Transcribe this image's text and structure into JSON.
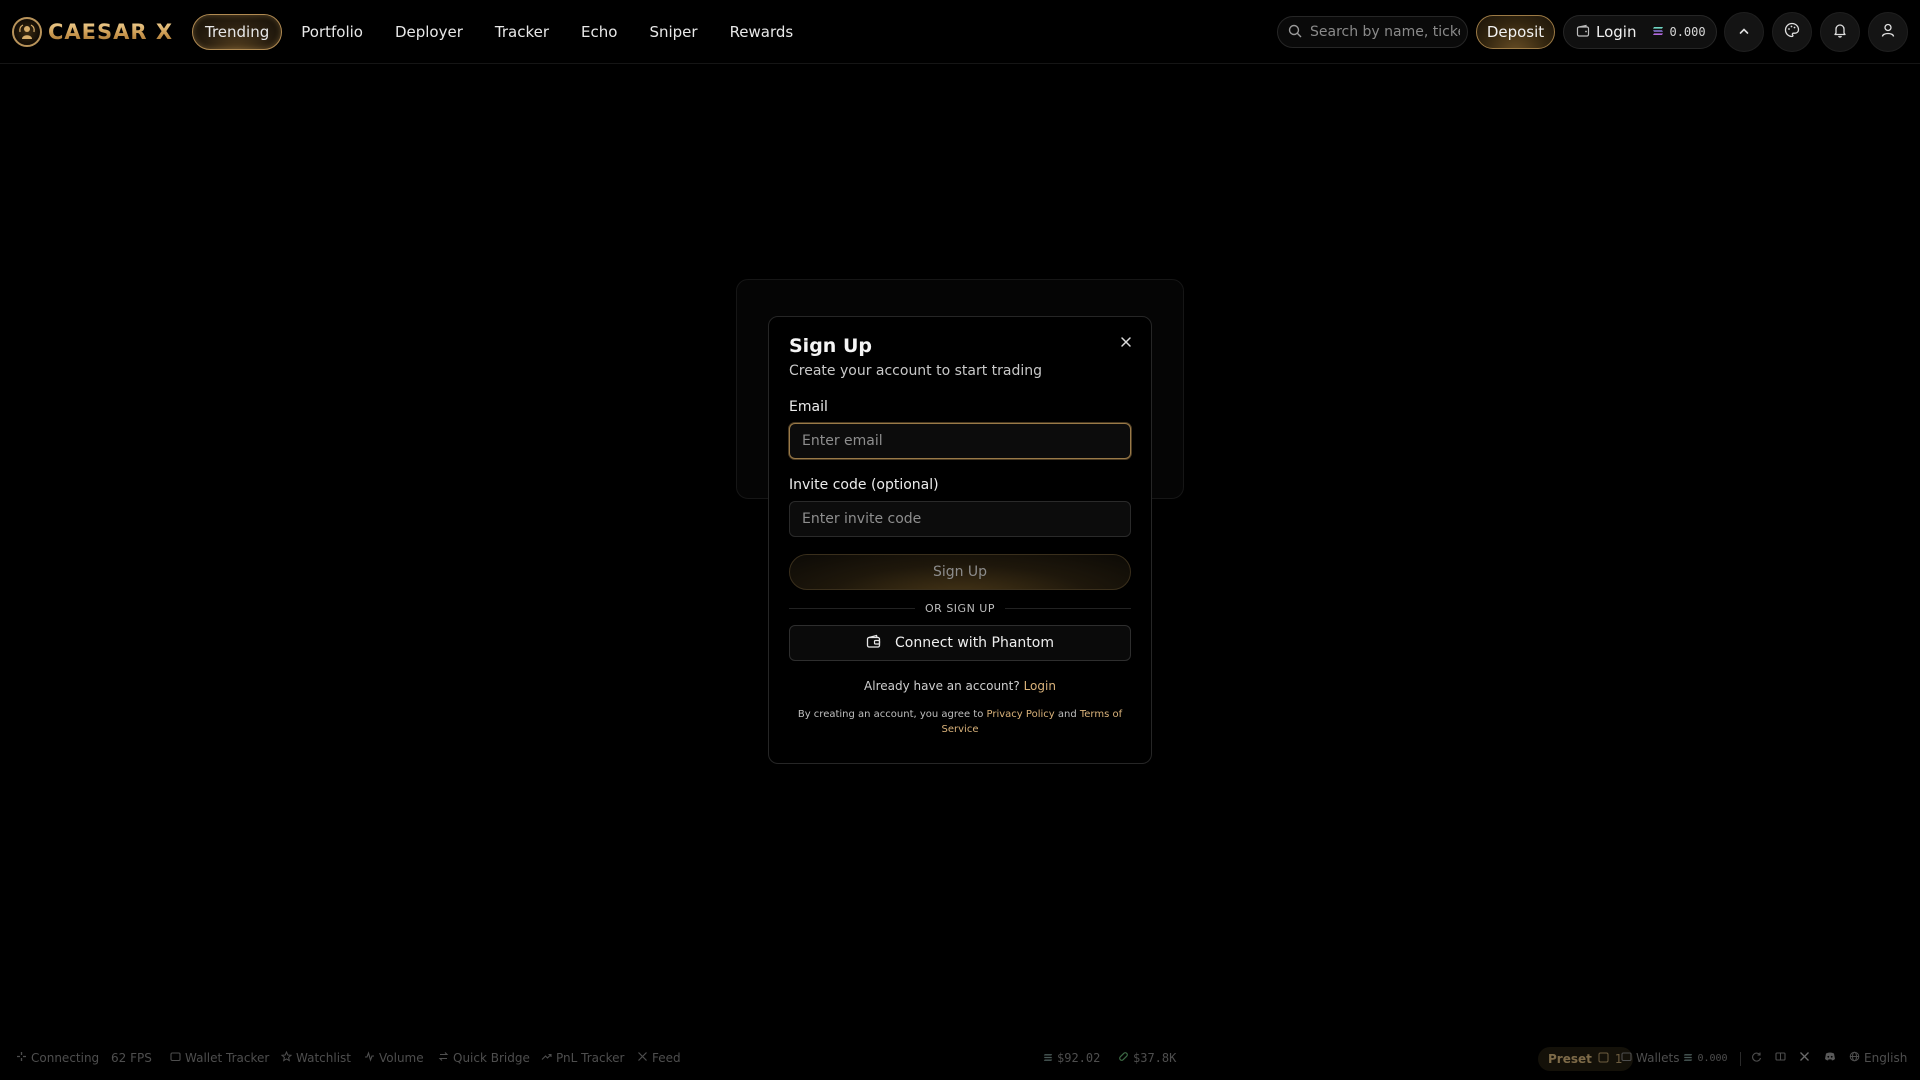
{
  "brand": {
    "name": "CAESAR X"
  },
  "nav": {
    "items": [
      {
        "label": "Trending",
        "active": true
      },
      {
        "label": "Portfolio",
        "active": false
      },
      {
        "label": "Deployer",
        "active": false
      },
      {
        "label": "Tracker",
        "active": false
      },
      {
        "label": "Echo",
        "active": false
      },
      {
        "label": "Sniper",
        "active": false
      },
      {
        "label": "Rewards",
        "active": false
      }
    ]
  },
  "header": {
    "search_placeholder": "Search by name, ticker",
    "deposit_label": "Deposit",
    "login_label": "Login",
    "balance": "0.000"
  },
  "modal": {
    "title": "Sign Up",
    "subtitle": "Create your account to start trading",
    "email_label": "Email",
    "email_placeholder": "Enter email",
    "invite_label": "Invite code (optional)",
    "invite_placeholder": "Enter invite code",
    "signup_button": "Sign Up",
    "divider_text": "OR SIGN UP",
    "phantom_button": "Connect with Phantom",
    "already_text": "Already have an account?",
    "login_link": "Login",
    "terms_prefix": "By creating an account, you agree to",
    "privacy_link": "Privacy Policy",
    "terms_and": "and",
    "terms_link": "Terms of Service"
  },
  "footer": {
    "connection_status": "Connecting",
    "fps": "62 FPS",
    "wallet_tracker": "Wallet Tracker",
    "watchlist": "Watchlist",
    "volume": "Volume",
    "quick_bridge": "Quick Bridge",
    "pnl_tracker": "PnL Tracker",
    "feed": "Feed",
    "sol_price": "$92.02",
    "other_price": "$37.8K",
    "preset_label": "Preset",
    "preset_key": "1",
    "wallets_label": "Wallets",
    "wallets_balance": "0.000",
    "language": "English"
  },
  "colors": {
    "accent_gold": "#d9b27a",
    "background": "#000000"
  }
}
